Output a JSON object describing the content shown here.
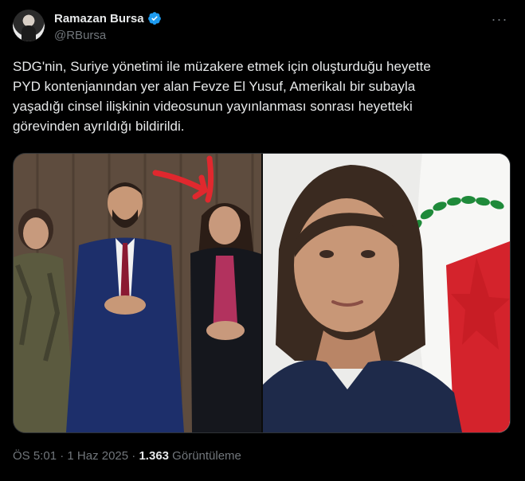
{
  "author": {
    "display_name": "Ramazan Bursa",
    "handle": "@RBursa",
    "avatar_icon": "person-avatar",
    "verified_icon": "verified-badge-icon"
  },
  "tweet": {
    "text": "SDG'nin, Suriye yönetimi ile müzakere etmek  için oluşturduğu heyette\nPYD kontenjanından yer alan Fevze El Yusuf, Amerikalı bir subayla\nyaşadığı cinsel ilişkinin videosunun yayınlanması sonrası heyetteki\ngörevinden ayrıldığı bildirildi."
  },
  "meta": {
    "time": "ÖS 5:01",
    "separator": " · ",
    "date": "1 Haz 2025",
    "separator2": " · ",
    "views_count": "1.363",
    "views_label": " Görüntüleme"
  },
  "colors": {
    "background": "#000000",
    "text": "#e7e9ea",
    "secondary": "#71767b",
    "verified": "#1d9bf0",
    "arrow": "#e0282e",
    "flag_red": "#d4232c",
    "flag_green": "#1f8a3a"
  }
}
